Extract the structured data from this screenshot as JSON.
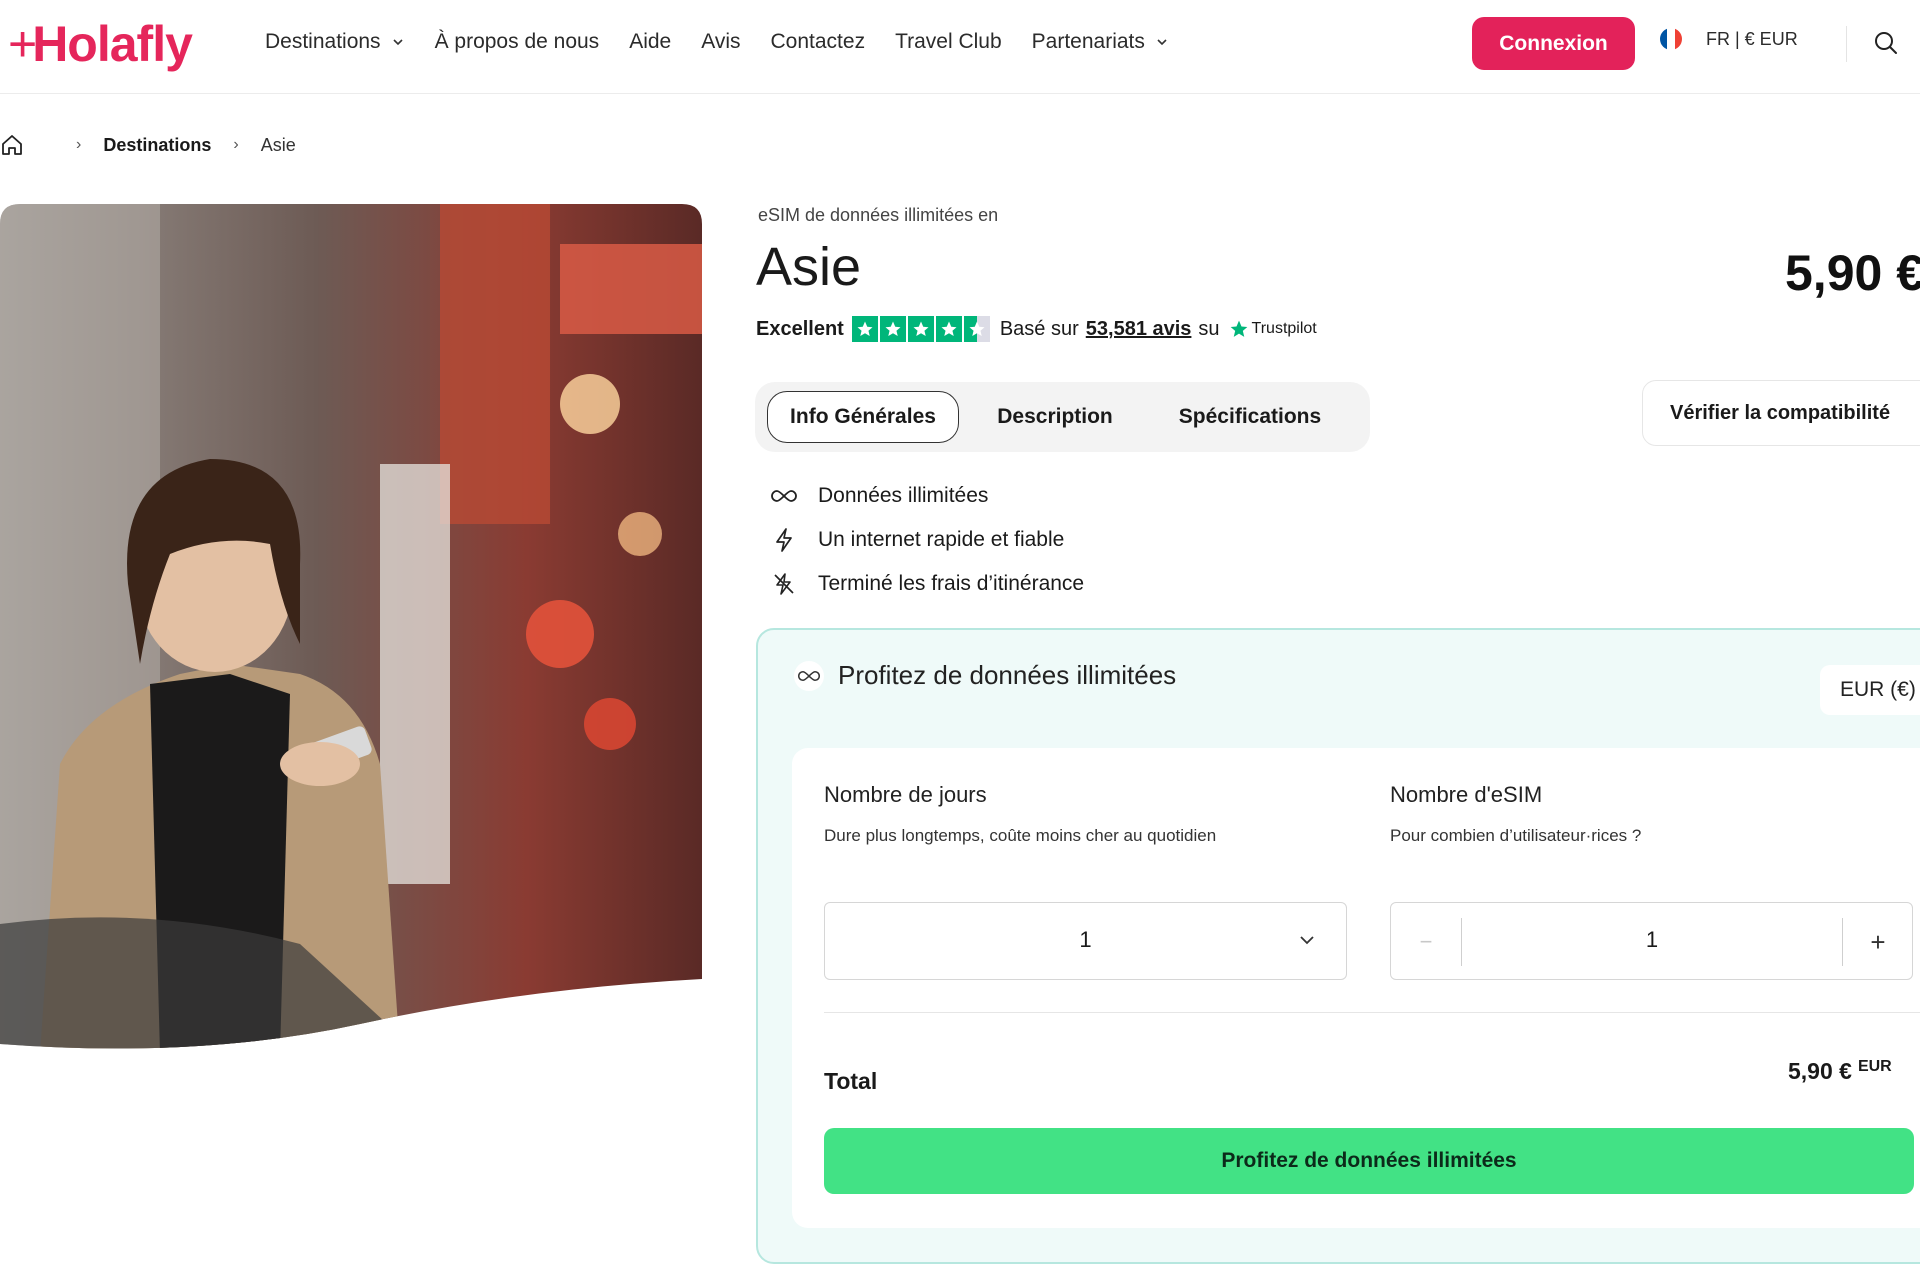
{
  "header": {
    "logo": "Holafly",
    "nav": [
      {
        "label": "Destinations",
        "dropdown": true
      },
      {
        "label": "À propos de nous",
        "dropdown": false
      },
      {
        "label": "Aide",
        "dropdown": false
      },
      {
        "label": "Avis",
        "dropdown": false
      },
      {
        "label": "Contactez",
        "dropdown": false
      },
      {
        "label": "Travel Club",
        "dropdown": false
      },
      {
        "label": "Partenariats",
        "dropdown": true
      }
    ],
    "login_label": "Connexion",
    "locale": "FR | € EUR"
  },
  "breadcrumb": {
    "items": [
      "Destinations",
      "Asie"
    ]
  },
  "product": {
    "eyebrow": "eSIM de données illimitées en",
    "title": "Asie",
    "price": "5,90 €",
    "rating": {
      "label": "Excellent",
      "stars": 4.5,
      "based_on": "Basé sur",
      "reviews_link": "53,581 avis",
      "on": "su",
      "provider": "Trustpilot"
    }
  },
  "tabs": [
    {
      "label": "Info Générales",
      "active": true
    },
    {
      "label": "Description",
      "active": false
    },
    {
      "label": "Spécifications",
      "active": false
    }
  ],
  "compat_button": "Vérifier la compatibilité",
  "features": [
    {
      "icon": "infinity-icon",
      "label": "Données illimitées"
    },
    {
      "icon": "lightning-icon",
      "label": "Un internet rapide et fiable"
    },
    {
      "icon": "no-roaming-icon",
      "label": "Terminé les frais d’itinérance"
    }
  ],
  "card": {
    "title": "Profitez de données illimitées",
    "currency": "EUR (€)",
    "days": {
      "label": "Nombre de jours",
      "hint": "Dure plus longtemps, coûte moins cher au quotidien",
      "value": "1"
    },
    "esims": {
      "label": "Nombre d'eSIM",
      "hint": "Pour combien d’utilisateur·rices ?",
      "value": "1",
      "minus": "−",
      "plus": "+"
    },
    "total_label": "Total",
    "total_value": "5,90 €",
    "total_currency": "EUR",
    "cta": "Profitez de données illimitées"
  },
  "colors": {
    "brand": "#e3225a",
    "cta": "#42e285",
    "card_bg": "#effaf9",
    "card_border": "#b6e7df",
    "trustpilot": "#00b67a"
  }
}
